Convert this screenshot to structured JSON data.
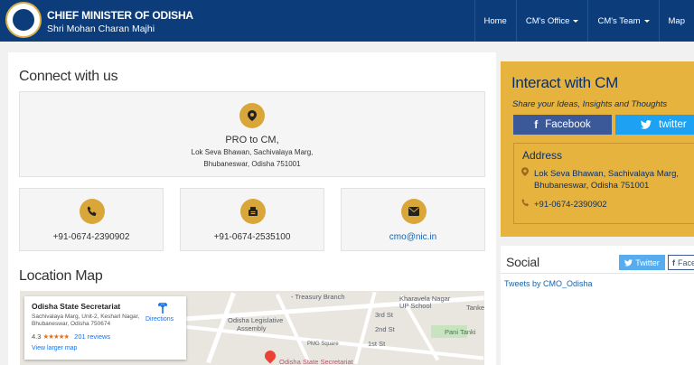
{
  "header": {
    "title": "CHIEF MINISTER OF ODISHA",
    "subtitle": "Shri Mohan Charan Majhi",
    "nav": [
      {
        "label": "Home"
      },
      {
        "label": "CM's Office"
      },
      {
        "label": "CM's Team"
      },
      {
        "label": "Map"
      }
    ]
  },
  "connect": {
    "heading": "Connect with us",
    "pro": {
      "title": "PRO to CM,",
      "line1": "Lok Seva Bhawan, Sachivalaya Marg,",
      "line2": "Bhubaneswar, Odisha 751001"
    },
    "cards": [
      {
        "value": "+91-0674-2390902",
        "icon": "phone-icon"
      },
      {
        "value": "+91-0674-2535100",
        "icon": "fax-icon"
      },
      {
        "value": "cmo@nic.in",
        "icon": "envelope-icon"
      }
    ]
  },
  "location": {
    "heading": "Location Map",
    "card": {
      "title": "Odisha State Secretariat",
      "address": "Sachivalaya Marg, Unit-2, Kesharl Nagar, Bhubaneswar, Odisha 750674",
      "rating": "4.3",
      "stars": "★★★★★",
      "reviews": "201 reviews",
      "directions": "Directions",
      "larger": "View larger map"
    },
    "labels": {
      "treasury": "- Treasury Branch",
      "kharavela1": "Kharavela Nagar",
      "kharavela2": "UP School",
      "assembly1": "Odisha Legislative",
      "assembly2": "Assembly",
      "road3": "3rd St",
      "road2": "2nd St",
      "road1": "1st St",
      "pmg": "PMG Square",
      "panitanki": "Pani Tanki",
      "tanke": "Tanke",
      "secretariat": "Odisha State Secretariat"
    }
  },
  "interact": {
    "title": "Interact with CM",
    "subtitle": "Share your Ideas, Insights and Thoughts",
    "facebook": "Facebook",
    "twitter": "twitter",
    "address_heading": "Address",
    "address_line1": "Lok Seva Bhawan, Sachivalaya Marg,",
    "address_line2": "Bhubaneswar, Odisha 751001",
    "phone": "+91-0674-2390902"
  },
  "social": {
    "title": "Social",
    "twitter_label": "Twitter",
    "facebook_label": "Face",
    "tweets_link": "Tweets by CMO_Odisha"
  },
  "colors": {
    "header_bg": "#0c3d7a",
    "accent_gold": "#e7b33f",
    "icon_gold": "#d9a63a",
    "facebook": "#3b5998",
    "twitter": "#1da1f2"
  }
}
